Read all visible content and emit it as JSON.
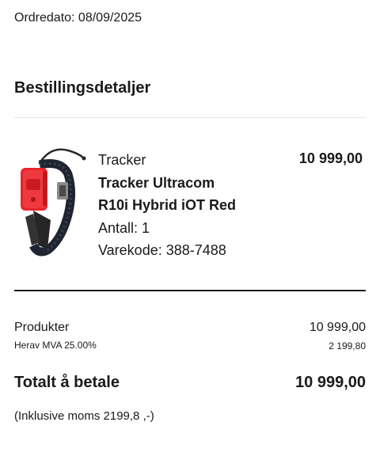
{
  "order": {
    "date_text": "Ordredato: 08/09/2025"
  },
  "details": {
    "title": "Bestillingsdetaljer"
  },
  "item": {
    "category": "Tracker",
    "name_line1": "Tracker Ultracom",
    "name_line2": "R10i Hybrid iOT Red",
    "quantity_text": "Antall: 1",
    "sku_text": "Varekode: 388-7488",
    "price": "10 999,00",
    "image_icon": "gps-dog-collar-tracker-red"
  },
  "summary": {
    "products_label": "Produkter",
    "products_value": "10 999,00",
    "vat_label": "Herav MVA 25.00%",
    "vat_value": "2 199,80",
    "total_label": "Totalt å betale",
    "total_value": "10 999,00",
    "inclusive_note": "(Inklusive moms 2199,8 ,-)"
  },
  "colors": {
    "text": "#1a1a1a",
    "divider": "#e6e6e6",
    "tracker_red": "#e8262c"
  }
}
